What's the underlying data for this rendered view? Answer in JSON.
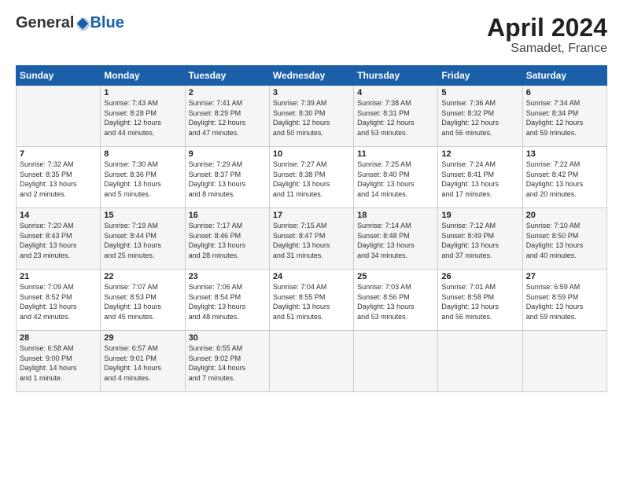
{
  "header": {
    "logo_general": "General",
    "logo_blue": "Blue",
    "title": "April 2024",
    "location": "Samadet, France"
  },
  "weekdays": [
    "Sunday",
    "Monday",
    "Tuesday",
    "Wednesday",
    "Thursday",
    "Friday",
    "Saturday"
  ],
  "weeks": [
    [
      {
        "day": "",
        "info": ""
      },
      {
        "day": "1",
        "info": "Sunrise: 7:43 AM\nSunset: 8:28 PM\nDaylight: 12 hours\nand 44 minutes."
      },
      {
        "day": "2",
        "info": "Sunrise: 7:41 AM\nSunset: 8:29 PM\nDaylight: 12 hours\nand 47 minutes."
      },
      {
        "day": "3",
        "info": "Sunrise: 7:39 AM\nSunset: 8:30 PM\nDaylight: 12 hours\nand 50 minutes."
      },
      {
        "day": "4",
        "info": "Sunrise: 7:38 AM\nSunset: 8:31 PM\nDaylight: 12 hours\nand 53 minutes."
      },
      {
        "day": "5",
        "info": "Sunrise: 7:36 AM\nSunset: 8:32 PM\nDaylight: 12 hours\nand 56 minutes."
      },
      {
        "day": "6",
        "info": "Sunrise: 7:34 AM\nSunset: 8:34 PM\nDaylight: 12 hours\nand 59 minutes."
      }
    ],
    [
      {
        "day": "7",
        "info": "Sunrise: 7:32 AM\nSunset: 8:35 PM\nDaylight: 13 hours\nand 2 minutes."
      },
      {
        "day": "8",
        "info": "Sunrise: 7:30 AM\nSunset: 8:36 PM\nDaylight: 13 hours\nand 5 minutes."
      },
      {
        "day": "9",
        "info": "Sunrise: 7:29 AM\nSunset: 8:37 PM\nDaylight: 13 hours\nand 8 minutes."
      },
      {
        "day": "10",
        "info": "Sunrise: 7:27 AM\nSunset: 8:38 PM\nDaylight: 13 hours\nand 11 minutes."
      },
      {
        "day": "11",
        "info": "Sunrise: 7:25 AM\nSunset: 8:40 PM\nDaylight: 13 hours\nand 14 minutes."
      },
      {
        "day": "12",
        "info": "Sunrise: 7:24 AM\nSunset: 8:41 PM\nDaylight: 13 hours\nand 17 minutes."
      },
      {
        "day": "13",
        "info": "Sunrise: 7:22 AM\nSunset: 8:42 PM\nDaylight: 13 hours\nand 20 minutes."
      }
    ],
    [
      {
        "day": "14",
        "info": "Sunrise: 7:20 AM\nSunset: 8:43 PM\nDaylight: 13 hours\nand 23 minutes."
      },
      {
        "day": "15",
        "info": "Sunrise: 7:19 AM\nSunset: 8:44 PM\nDaylight: 13 hours\nand 25 minutes."
      },
      {
        "day": "16",
        "info": "Sunrise: 7:17 AM\nSunset: 8:46 PM\nDaylight: 13 hours\nand 28 minutes."
      },
      {
        "day": "17",
        "info": "Sunrise: 7:15 AM\nSunset: 8:47 PM\nDaylight: 13 hours\nand 31 minutes."
      },
      {
        "day": "18",
        "info": "Sunrise: 7:14 AM\nSunset: 8:48 PM\nDaylight: 13 hours\nand 34 minutes."
      },
      {
        "day": "19",
        "info": "Sunrise: 7:12 AM\nSunset: 8:49 PM\nDaylight: 13 hours\nand 37 minutes."
      },
      {
        "day": "20",
        "info": "Sunrise: 7:10 AM\nSunset: 8:50 PM\nDaylight: 13 hours\nand 40 minutes."
      }
    ],
    [
      {
        "day": "21",
        "info": "Sunrise: 7:09 AM\nSunset: 8:52 PM\nDaylight: 13 hours\nand 42 minutes."
      },
      {
        "day": "22",
        "info": "Sunrise: 7:07 AM\nSunset: 8:53 PM\nDaylight: 13 hours\nand 45 minutes."
      },
      {
        "day": "23",
        "info": "Sunrise: 7:06 AM\nSunset: 8:54 PM\nDaylight: 13 hours\nand 48 minutes."
      },
      {
        "day": "24",
        "info": "Sunrise: 7:04 AM\nSunset: 8:55 PM\nDaylight: 13 hours\nand 51 minutes."
      },
      {
        "day": "25",
        "info": "Sunrise: 7:03 AM\nSunset: 8:56 PM\nDaylight: 13 hours\nand 53 minutes."
      },
      {
        "day": "26",
        "info": "Sunrise: 7:01 AM\nSunset: 8:58 PM\nDaylight: 13 hours\nand 56 minutes."
      },
      {
        "day": "27",
        "info": "Sunrise: 6:59 AM\nSunset: 8:59 PM\nDaylight: 13 hours\nand 59 minutes."
      }
    ],
    [
      {
        "day": "28",
        "info": "Sunrise: 6:58 AM\nSunset: 9:00 PM\nDaylight: 14 hours\nand 1 minute."
      },
      {
        "day": "29",
        "info": "Sunrise: 6:57 AM\nSunset: 9:01 PM\nDaylight: 14 hours\nand 4 minutes."
      },
      {
        "day": "30",
        "info": "Sunrise: 6:55 AM\nSunset: 9:02 PM\nDaylight: 14 hours\nand 7 minutes."
      },
      {
        "day": "",
        "info": ""
      },
      {
        "day": "",
        "info": ""
      },
      {
        "day": "",
        "info": ""
      },
      {
        "day": "",
        "info": ""
      }
    ]
  ]
}
